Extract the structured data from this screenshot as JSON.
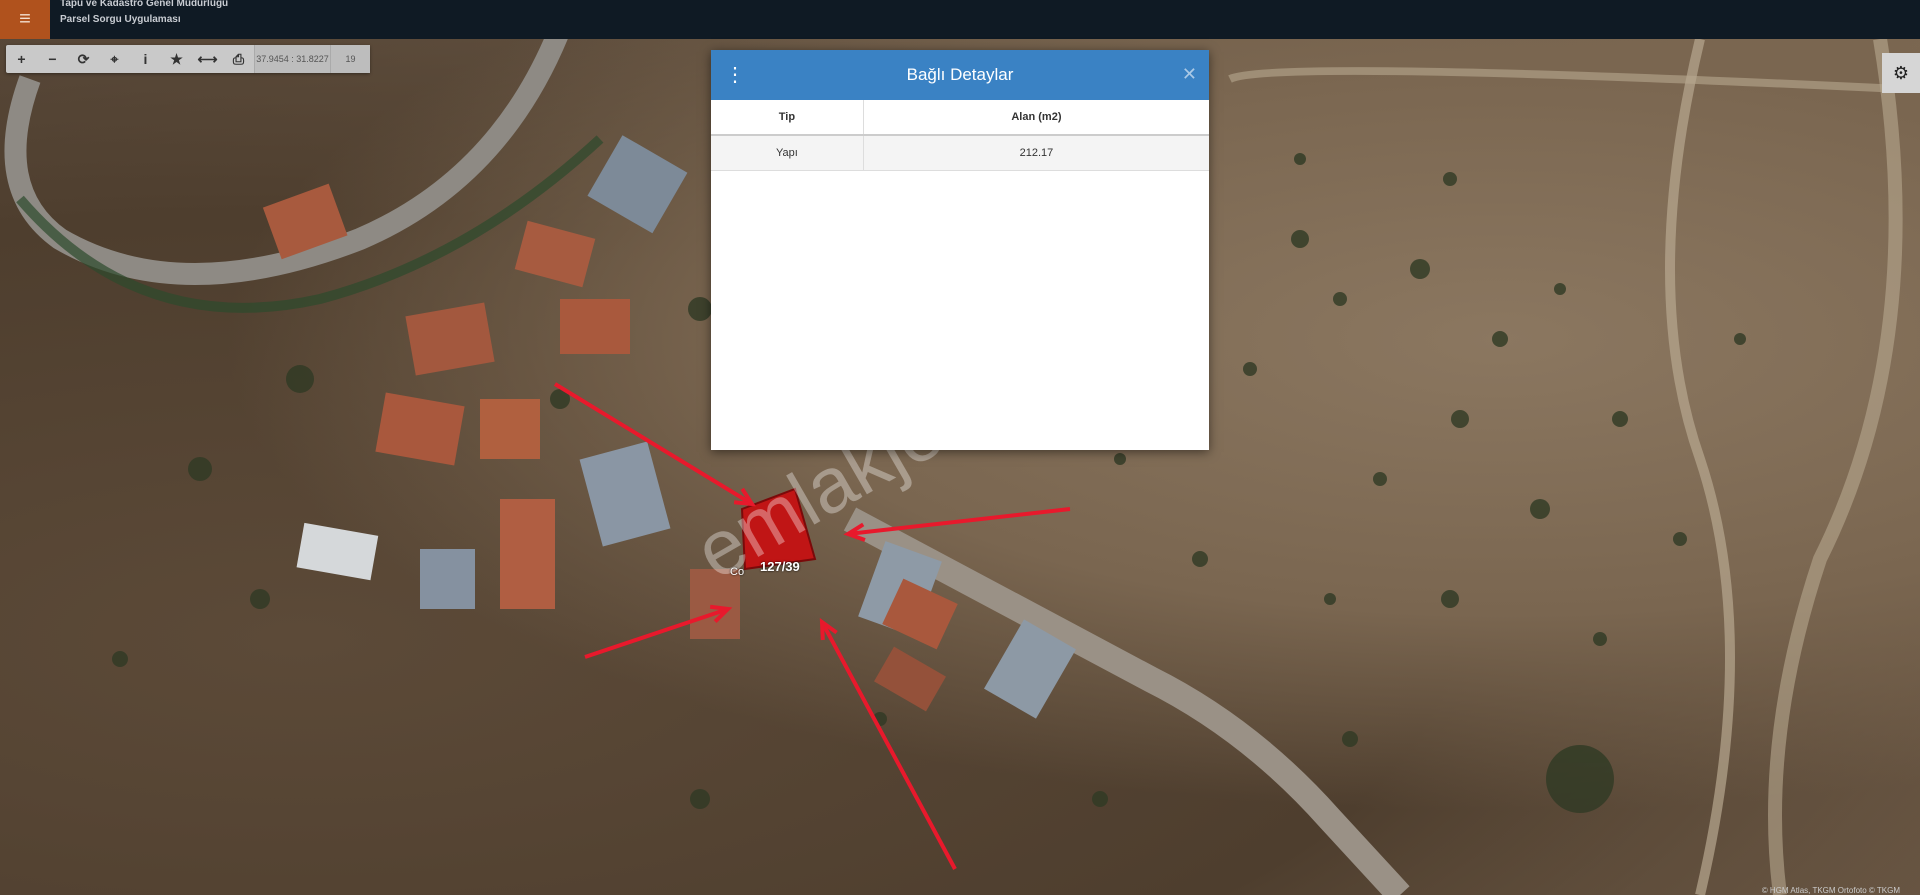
{
  "app": {
    "menu_icon": "hamburger-icon",
    "title_line1": "Tapu ve Kadastro Genel Müdürlüğü",
    "title_line2": "Parsel Sorgu Uygulaması"
  },
  "toolbar": {
    "buttons": [
      {
        "name": "zoom-in-icon",
        "glyph": "+"
      },
      {
        "name": "zoom-out-icon",
        "glyph": "−"
      },
      {
        "name": "refresh-icon",
        "glyph": "⟳"
      },
      {
        "name": "locate-icon",
        "glyph": "⌖"
      },
      {
        "name": "info-icon",
        "glyph": "i"
      },
      {
        "name": "star-icon",
        "glyph": "★"
      },
      {
        "name": "measure-icon",
        "glyph": "⟷"
      },
      {
        "name": "print-icon",
        "glyph": "⎙"
      }
    ],
    "coordinates": "37.9454 : 31.8227",
    "zoom": "19"
  },
  "settings_icon": "gear-icon",
  "dialog": {
    "title": "Bağlı Detaylar",
    "menu_icon": "kebab-icon",
    "close_icon": "close-icon",
    "columns": [
      "Tip",
      "Alan (m2)"
    ],
    "rows": [
      [
        "Yapı",
        "212.17"
      ]
    ]
  },
  "map": {
    "parcel_label": "127/39",
    "partial_label": "Co",
    "watermark": "emlakjet.com",
    "attribution": "© HGM Atlas, TKGM Ortofoto © TKGM",
    "parcel_color": "#c01515",
    "arrow_color": "#e8192c"
  }
}
